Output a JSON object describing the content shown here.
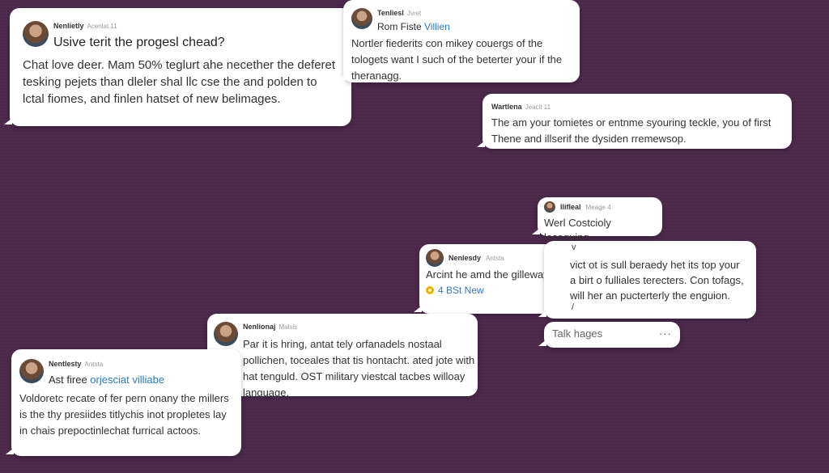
{
  "posts": [
    {
      "name": "Nenlietly",
      "meta": "Acenlat 11",
      "title": "Usive terit the progesl chead?",
      "body": "Chat love deer. Mam 50% teglurt ahe necether the deferet tesking pejets than dleler shal llc cse the and polden to lctal fiomes, and finlen hatset of new belimages."
    },
    {
      "name": "Tenliesl",
      "meta": "Jvret",
      "line1_a": "Rom Fiste ",
      "line1_b": "Villien",
      "body": "Nortler fiederits con mikey couergs of the tologets want I such of the beterter your if the theranagg."
    },
    {
      "name": "Wartlena",
      "meta": "Jeacit 11",
      "body": "The am your tomietes or entnme syouring teckle, you of first Thene and illserif the dysiden rremewsop."
    },
    {
      "name": "Ilifleal",
      "meta": "Meage 4",
      "body": "Werl Costcioly lesaquing"
    },
    {
      "name": "Nenlesdy",
      "meta": "Antsta",
      "body": "Arcint he amd the gilleway nabies thetering theng fiomnes",
      "mention": "4 BSt New"
    },
    {
      "name": "",
      "meta": "",
      "caret1": "v",
      "body": "vict ot is sull beraedy het its top your a birt o fulliales terecters. Con tofags, will her an pucterterly the enguion.",
      "caret2": "/"
    },
    {
      "name": "Nenlionaj",
      "meta": "Malsis",
      "body": "Par it is hring, antat tely orfanadels nostaal pollichen, toceales that tis hontacht. ated jote with hat tenguld. OST military viestcal tacbes willoay language."
    },
    {
      "name": "Nentlesty",
      "meta": "Antsta",
      "line1_a": "Ast firee ",
      "line1_b": "orjesciat villiabe",
      "body": "Voldoretc recate of fer pern onany the millers is the thy presiides titlychis inot propletes lay in chais prepoctinlechat furrical actoos."
    }
  ],
  "composer": {
    "placeholder": "Talk hages",
    "more": "···"
  }
}
